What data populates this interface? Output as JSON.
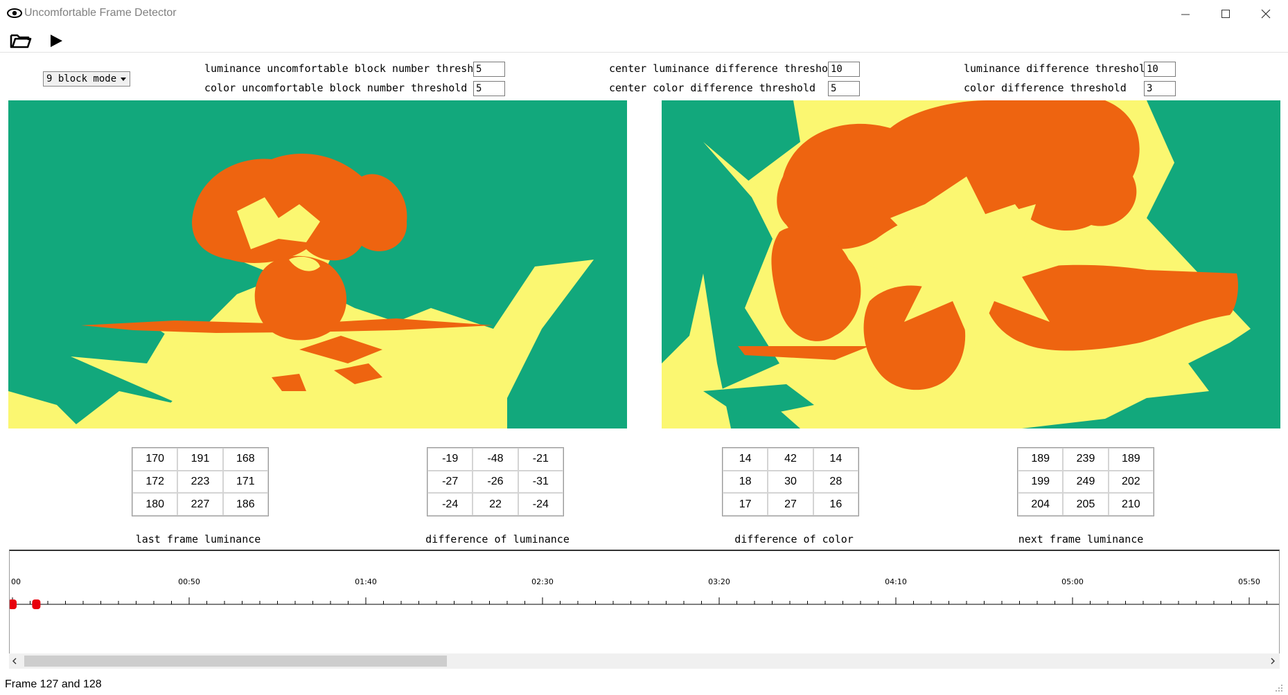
{
  "window": {
    "title": "Uncomfortable Frame Detector"
  },
  "toolbar": {
    "open_icon": "folder-open-icon",
    "play_icon": "play-icon"
  },
  "controls": {
    "mode_select": {
      "value": "9 block mode"
    },
    "params": [
      {
        "label": "luminance uncomfortable block number threshold",
        "value": "5"
      },
      {
        "label": "color uncomfortable block number threshold",
        "value": "5"
      },
      {
        "label": "center luminance difference threshold",
        "value": "10"
      },
      {
        "label": "center color difference threshold",
        "value": "5"
      },
      {
        "label": "luminance difference threshold",
        "value": "10"
      },
      {
        "label": "color difference threshold",
        "value": "3"
      }
    ]
  },
  "colors": {
    "frame_background": "#12a87c",
    "orange": "#ee6410",
    "yellow": "#fbf771",
    "marker": "#e8000d"
  },
  "grids": {
    "last_frame_luminance": {
      "caption": "last frame luminance",
      "cells": [
        "170",
        "191",
        "168",
        "172",
        "223",
        "171",
        "180",
        "227",
        "186"
      ]
    },
    "difference_of_luminance": {
      "caption": "difference of luminance",
      "cells": [
        "-19",
        "-48",
        "-21",
        "-27",
        "-26",
        "-31",
        "-24",
        "22",
        "-24"
      ]
    },
    "difference_of_color": {
      "caption": "difference of color",
      "cells": [
        "14",
        "42",
        "14",
        "18",
        "30",
        "28",
        "17",
        "27",
        "16"
      ]
    },
    "next_frame_luminance": {
      "caption": "next frame luminance",
      "cells": [
        "189",
        "239",
        "189",
        "199",
        "249",
        "202",
        "204",
        "205",
        "210"
      ]
    }
  },
  "timeline": {
    "tick_labels": [
      "00",
      "00:50",
      "01:40",
      "02:30",
      "03:20",
      "04:10",
      "05:00",
      "05:50"
    ],
    "marker_seconds": [
      0,
      4
    ]
  },
  "status": {
    "text": "Frame 127 and 128"
  }
}
